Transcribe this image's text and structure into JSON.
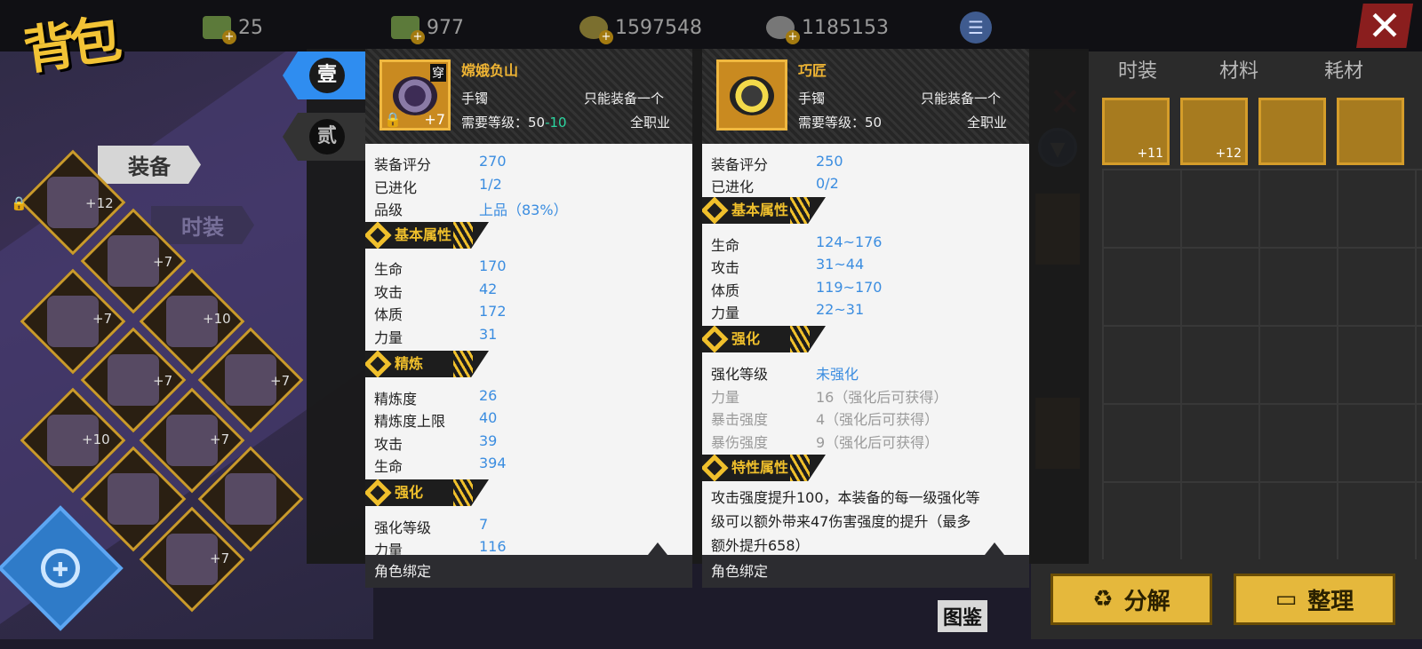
{
  "topbar": {
    "title": "背包",
    "currencies": [
      {
        "name": "money-icon",
        "value": "25"
      },
      {
        "name": "money-icon",
        "value": "977"
      },
      {
        "name": "gold-coin-icon",
        "value": "1597548"
      },
      {
        "name": "silver-coin-icon",
        "value": "1185153"
      }
    ]
  },
  "right_tabs": [
    "时装",
    "材料",
    "耗材"
  ],
  "inventory_levels": [
    "+11",
    "+12"
  ],
  "left": {
    "tab_equip": "装备",
    "tab_fashion": "时装",
    "slot_levels": [
      "+12",
      "+7",
      "+7",
      "+10",
      "+7",
      "+7",
      "+10",
      "+7",
      "+7"
    ]
  },
  "index_tabs": [
    "壹",
    "贰"
  ],
  "panel1": {
    "name": "嫦娥负山",
    "wear_tag": "穿",
    "plus_level": "+7",
    "slot": "手镯",
    "limit": "只能装备一个",
    "level_req_label": "需要等级：50",
    "level_req_reduce": "-10",
    "job": "全职业",
    "stats_top": [
      {
        "label": "装备评分",
        "value": "270"
      },
      {
        "label": "已进化",
        "value": "1/2"
      },
      {
        "label": "品级",
        "value": "上品（83%）"
      }
    ],
    "sec_basic": "基本属性",
    "basic": [
      {
        "label": "生命",
        "value": "170"
      },
      {
        "label": "攻击",
        "value": "42"
      },
      {
        "label": "体质",
        "value": "172"
      },
      {
        "label": "力量",
        "value": "31"
      }
    ],
    "sec_refine": "精炼",
    "refine": [
      {
        "label": "精炼度",
        "value": "26"
      },
      {
        "label": "精炼度上限",
        "value": "40"
      },
      {
        "label": "攻击",
        "value": "39"
      },
      {
        "label": "生命",
        "value": "394"
      }
    ],
    "sec_enhance": "强化",
    "enhance": [
      {
        "label": "强化等级",
        "value": "7"
      },
      {
        "label": "力量",
        "value": "116"
      }
    ],
    "footer": "角色绑定"
  },
  "panel2": {
    "name": "巧匠",
    "slot": "手镯",
    "limit": "只能装备一个",
    "level_req_label": "需要等级：50",
    "job": "全职业",
    "stats_top": [
      {
        "label": "装备评分",
        "value": "250"
      },
      {
        "label": "已进化",
        "value": "0/2"
      }
    ],
    "sec_basic": "基本属性",
    "basic": [
      {
        "label": "生命",
        "value": "124~176"
      },
      {
        "label": "攻击",
        "value": "31~44"
      },
      {
        "label": "体质",
        "value": "119~170"
      },
      {
        "label": "力量",
        "value": "22~31"
      }
    ],
    "sec_enhance": "强化",
    "enhance_level": {
      "label": "强化等级",
      "value": "未强化"
    },
    "enhance_locked": [
      {
        "label": "力量",
        "value": "16（强化后可获得）"
      },
      {
        "label": "暴击强度",
        "value": "4（强化后可获得）"
      },
      {
        "label": "暴伤强度",
        "value": "9（强化后可获得）"
      }
    ],
    "sec_trait": "特性属性",
    "trait_lines": [
      "攻击强度提升100，本装备的每一级强化等",
      "级可以额外带来47伤害强度的提升（最多",
      "额外提升658）"
    ],
    "footer": "角色绑定"
  },
  "buttons": {
    "decompose": "分解",
    "sort": "整理",
    "codex": "图鉴"
  },
  "colors": {
    "gold": "#f0b534",
    "value_blue": "#3b8de0",
    "reduce_green": "#2bd6a0",
    "accent_blue": "#2f8df0"
  }
}
